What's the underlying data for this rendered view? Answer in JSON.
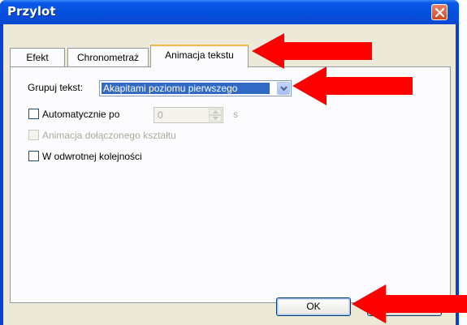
{
  "window": {
    "title": "Przylot",
    "close_icon": "close-icon"
  },
  "tabs": [
    {
      "label": "Efekt",
      "active": false
    },
    {
      "label": "Chronometraż",
      "active": false
    },
    {
      "label": "Animacja tekstu",
      "active": true
    }
  ],
  "group_text": {
    "label": "Grupuj tekst:",
    "selected": "Akapitami poziomu pierwszego",
    "arrow_icon": "chevron-down-icon"
  },
  "auto_after": {
    "label": "Automatycznie po",
    "checked": false,
    "value": "0",
    "unit": "s"
  },
  "animate_attached_shape": {
    "label": "Animacja dołączonego kształtu",
    "checked": false,
    "enabled": false
  },
  "reverse_order": {
    "label": "W odwrotnej kolejności",
    "checked": false
  },
  "buttons": {
    "ok_label": "OK"
  },
  "annotations": {
    "arrow_color": "#ff0000"
  }
}
